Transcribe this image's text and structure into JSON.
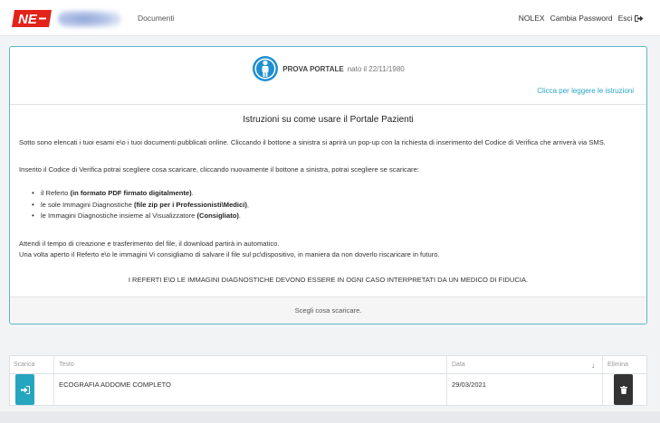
{
  "navbar": {
    "documents_label": "Documenti",
    "user_label": "NOLEX",
    "change_password_label": "Cambia Password",
    "logout_label": "Esci"
  },
  "patient": {
    "name": "PROVA PORTALE",
    "dob": "nato il 22/11/1980",
    "instructions_link": "Clicca per leggere le istruzioni"
  },
  "instructions": {
    "title": "Istruzioni su come usare il Portale Pazienti",
    "p1": "Sotto sono elencati i tuoi esami e\\o i tuoi documenti pubblicati online. Cliccando il bottone a sinistra si aprirà un pop-up con la richiesta di inserimento del Codice di Verifica che arriverà via SMS.",
    "p2": "Inserito il Codice di Verifica potrai scegliere cosa scaricare, cliccando nuovamente il bottone a sinistra, potrai scegliere se scaricare:",
    "bullets": [
      {
        "text": "il Referto ",
        "bold": "(in formato PDF firmato digitalmente)",
        "tail": "."
      },
      {
        "text": "le sole Immagini Diagnostiche ",
        "bold": "(file zip per i Professionisti\\Medici)",
        "tail": ","
      },
      {
        "text": "le Immagini Diagnostiche insieme al Visualizzatore ",
        "bold": "(Consigliato)",
        "tail": "."
      }
    ],
    "p3": "Attendi il tempo di creazione e trasferimento del file, il download partirà in automatico.",
    "p4": "Una volta aperto il Referto e\\o le immagini Vi consigliamo di salvare il file sul pc\\dispositivo, in maniera da non doverlo riscaricare in futuro.",
    "warning": "I REFERTI E\\O LE IMMAGINI DIAGNOSTICHE DEVONO ESSERE IN OGNI CASO INTERPRETATI DA UN MEDICO DI FIDUCIA.",
    "footer": "Scegli cosa scaricare."
  },
  "table": {
    "headers": {
      "scarica": "Scarica",
      "testo": "Testo",
      "data": "Data",
      "sort": "↓",
      "elimina": "Elimina"
    },
    "rows": [
      {
        "testo": "ECOGRAFIA ADDOME COMPLETO",
        "data": "29/03/2021"
      }
    ]
  },
  "colors": {
    "accent": "#26a5bf",
    "brand_red": "#e2231a",
    "card_border": "#5bb8c7"
  },
  "icons": {
    "logo": "ne-logo",
    "patient": "user-circle-icon",
    "logout": "sign-out-icon",
    "download": "sign-in-icon",
    "delete": "trash-icon"
  }
}
